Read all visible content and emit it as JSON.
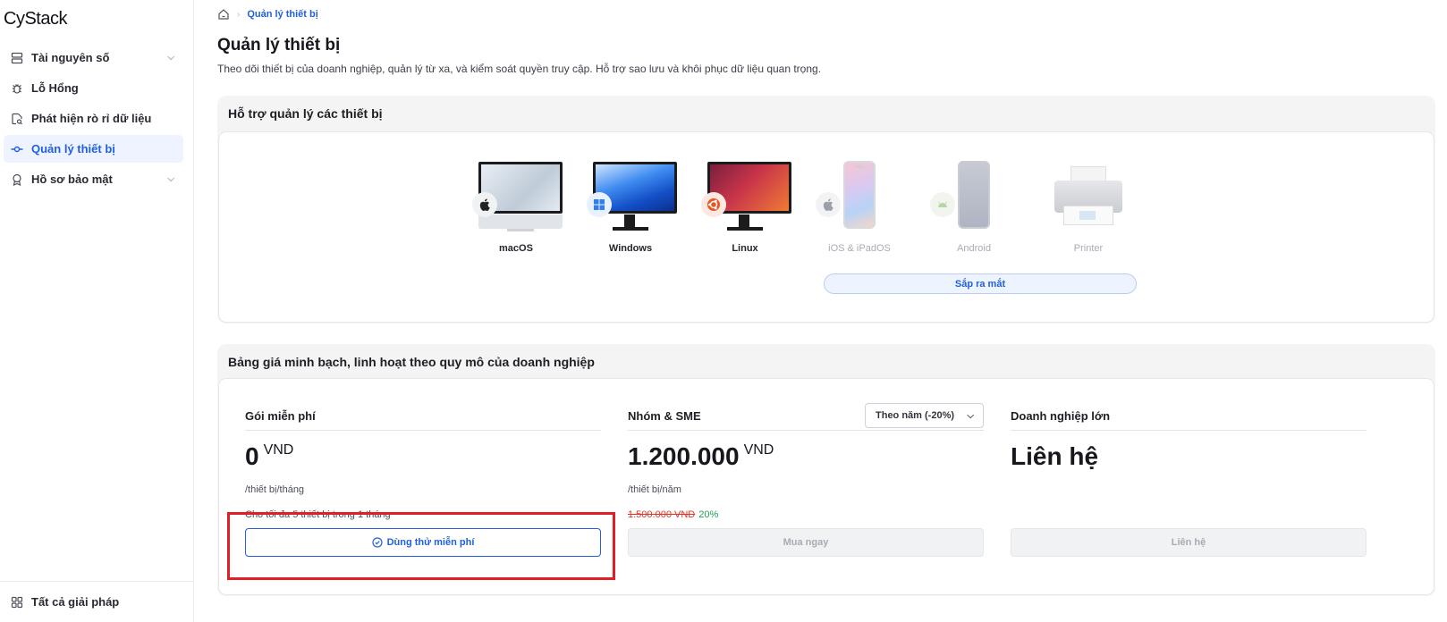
{
  "sidebar": {
    "logo": "CyStack",
    "items": [
      {
        "label": "Tài nguyên số",
        "icon": "server-icon",
        "has_chevron": true,
        "active": false
      },
      {
        "label": "Lỗ Hổng",
        "icon": "bug-icon",
        "has_chevron": false,
        "active": false
      },
      {
        "label": "Phát hiện rò rỉ dữ liệu",
        "icon": "file-search-icon",
        "has_chevron": false,
        "active": false
      },
      {
        "label": "Quản lý thiết bị",
        "icon": "device-node-icon",
        "has_chevron": false,
        "active": true
      },
      {
        "label": "Hồ sơ bảo mật",
        "icon": "award-icon",
        "has_chevron": true,
        "active": false
      }
    ],
    "footer_label": "Tất cả giải pháp"
  },
  "breadcrumb": {
    "current": "Quản lý thiết bị"
  },
  "page": {
    "title": "Quản lý thiết bị",
    "description": "Theo dõi thiết bị của doanh nghiệp, quản lý từ xa, và kiểm soát quyền truy cập. Hỗ trợ sao lưu và khôi phục dữ liệu quan trọng."
  },
  "devices_panel": {
    "title": "Hỗ trợ quản lý các thiết bị",
    "devices": [
      {
        "label": "macOS",
        "icon": "apple-icon",
        "enabled": true
      },
      {
        "label": "Windows",
        "icon": "windows-icon",
        "enabled": true
      },
      {
        "label": "Linux",
        "icon": "ubuntu-icon",
        "enabled": true
      },
      {
        "label": "iOS & iPadOS",
        "icon": "apple-icon",
        "enabled": false
      },
      {
        "label": "Android",
        "icon": "android-icon",
        "enabled": false
      },
      {
        "label": "Printer",
        "icon": "printer-icon",
        "enabled": false
      }
    ],
    "coming_soon_label": "Sắp ra mắt"
  },
  "pricing_panel": {
    "title": "Bảng giá minh bạch, linh hoạt theo quy mô của doanh nghiệp",
    "plans": [
      {
        "name": "Gói miễn phí",
        "amount": "0",
        "currency": "VND",
        "unit": "/thiết bị/tháng",
        "note": "Cho tối đa 5 thiết bị trong 1 tháng",
        "button": "Dùng thử miễn phí"
      },
      {
        "name": "Nhóm & SME",
        "amount": "1.200.000",
        "currency": "VND",
        "unit": "/thiết bị/năm",
        "old_price": "1.500.000 VND",
        "discount": "20%",
        "button": "Mua ngay",
        "billing_select": "Theo năm (-20%)"
      },
      {
        "name": "Doanh nghiệp lớn",
        "amount": "Liên hệ",
        "currency": "",
        "unit": "",
        "button": "Liên hệ"
      }
    ]
  },
  "colors": {
    "accent": "#1f5fe0",
    "highlight_box": "#e11d25",
    "discount": "#1e9e54",
    "strike": "#e0352b"
  }
}
